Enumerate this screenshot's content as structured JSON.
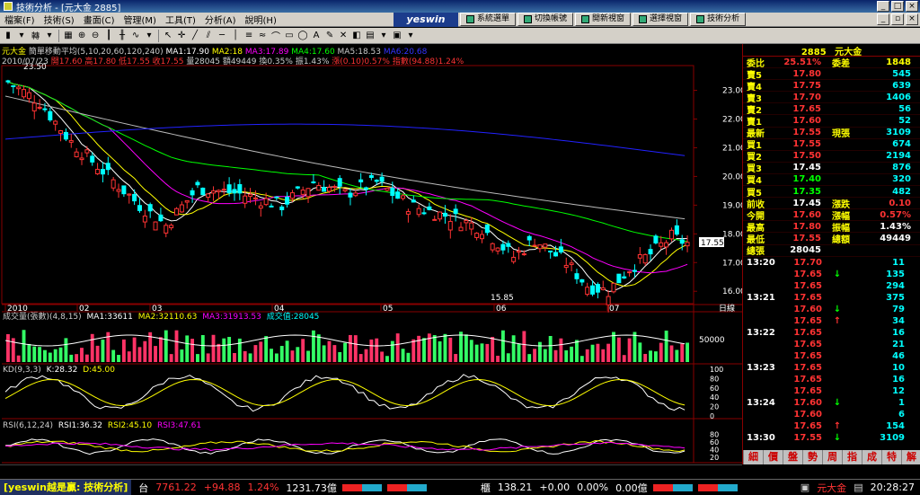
{
  "window": {
    "title": "技術分析 - [元大金 2885]"
  },
  "menu": {
    "items": [
      "檔案(F)",
      "技術(S)",
      "畫面(C)",
      "管理(M)",
      "工具(T)",
      "分析(A)",
      "說明(H)"
    ],
    "logo": "yeswin",
    "top_buttons": [
      "系統選單",
      "切換帳號",
      "開新視窗",
      "選擇視窗",
      "技術分析"
    ]
  },
  "toolbar": {
    "bar_mode_label": "轉"
  },
  "chart_header": {
    "line1_stock": "元大金",
    "line1_rest": "簡單移動平均(5,10,20,60,120,240)",
    "ma1": "MA1:17.90",
    "ma2": "MA2:18",
    "ma3": "MA3:17.89",
    "ma4": "MA4:17.60",
    "ma5": "MA5:18.53",
    "ma6": "MA6:20.68",
    "line2_date": "2010/07/23",
    "line2_open": "開17.60",
    "line2_high": "高17.80",
    "line2_low": "低17.55",
    "line2_close": "收17.55",
    "line2_vol": "量28045",
    "line2_amt": "額49449",
    "line2_turn": "換0.35%",
    "line2_amp": "振1.43%",
    "line2_chg": "漲(0.10)0.57%",
    "line2_idx": "指數(94.88)1.24%",
    "max_label": "23.50",
    "min_label": "15.85",
    "price_tag": "17.55",
    "volume_header": {
      "name": "成交量(張數)(4,8,15)",
      "ma1": "MA1:33611",
      "ma2": "MA2:32110.63",
      "ma3": "MA3:31913.53",
      "current": "成交值:28045"
    },
    "kd_header": {
      "name": "KD(9,3,3)",
      "k": "K:28.32",
      "d": "D:45.00"
    },
    "rsi_header": {
      "name": "RSI(6,12,24)",
      "rsi1": "RSI1:36.32",
      "rsi2": "RSI2:45.10",
      "rsi3": "RSI3:47.61"
    },
    "period_label": "日線"
  },
  "chart_data": {
    "type": "candlestick",
    "x_ticks": [
      "2010",
      "02",
      "03",
      "04",
      "05",
      "06",
      "07"
    ],
    "price_axis": [
      "23.00",
      "22.00",
      "21.00",
      "20.00",
      "19.00",
      "18.00",
      "17.00",
      "16.00"
    ],
    "volume_axis": [
      "50000"
    ],
    "kd_axis": [
      "100",
      "80",
      "60",
      "40",
      "20",
      "0"
    ],
    "rsi_axis": [
      "80",
      "60",
      "40",
      "20"
    ],
    "ylim_price": [
      15.6,
      23.8
    ],
    "max_close": 23.5,
    "min_close": 15.85,
    "last_close": 17.55
  },
  "quote": {
    "title_code": "2885",
    "title_name": "元大金",
    "rows": [
      {
        "lbl": "委比",
        "v1": "25.51%",
        "lbl2": "委差",
        "v2": "1848",
        "c1": "#f33",
        "c2": "#ff0"
      },
      {
        "lbl": "賣5",
        "v1": "17.80",
        "lbl2": "",
        "v2": "545",
        "c1": "#f33",
        "c2": "#0ff"
      },
      {
        "lbl": "賣4",
        "v1": "17.75",
        "lbl2": "",
        "v2": "639",
        "c1": "#f33",
        "c2": "#0ff"
      },
      {
        "lbl": "賣3",
        "v1": "17.70",
        "lbl2": "",
        "v2": "1406",
        "c1": "#f33",
        "c2": "#0ff"
      },
      {
        "lbl": "賣2",
        "v1": "17.65",
        "lbl2": "",
        "v2": "56",
        "c1": "#f33",
        "c2": "#0ff"
      },
      {
        "lbl": "賣1",
        "v1": "17.60",
        "lbl2": "",
        "v2": "52",
        "c1": "#f33",
        "c2": "#0ff"
      },
      {
        "lbl": "最新",
        "v1": "17.55",
        "lbl2": "現張",
        "v2": "3109",
        "c1": "#f33",
        "c2": "#0ff"
      },
      {
        "lbl": "買1",
        "v1": "17.55",
        "lbl2": "",
        "v2": "674",
        "c1": "#f33",
        "c2": "#0ff"
      },
      {
        "lbl": "買2",
        "v1": "17.50",
        "lbl2": "",
        "v2": "2194",
        "c1": "#f33",
        "c2": "#0ff"
      },
      {
        "lbl": "買3",
        "v1": "17.45",
        "lbl2": "",
        "v2": "876",
        "c1": "#fff",
        "c2": "#0ff"
      },
      {
        "lbl": "買4",
        "v1": "17.40",
        "lbl2": "",
        "v2": "320",
        "c1": "#0f0",
        "c2": "#0ff"
      },
      {
        "lbl": "買5",
        "v1": "17.35",
        "lbl2": "",
        "v2": "482",
        "c1": "#0f0",
        "c2": "#0ff"
      },
      {
        "lbl": "前收",
        "v1": "17.45",
        "lbl2": "漲跌",
        "v2": "0.10",
        "c1": "#fff",
        "c2": "#f33"
      },
      {
        "lbl": "今開",
        "v1": "17.60",
        "lbl2": "漲幅",
        "v2": "0.57%",
        "c1": "#f33",
        "c2": "#f33"
      },
      {
        "lbl": "最高",
        "v1": "17.80",
        "lbl2": "振幅",
        "v2": "1.43%",
        "c1": "#f33",
        "c2": "#fff"
      },
      {
        "lbl": "最低",
        "v1": "17.55",
        "lbl2": "總額",
        "v2": "49449",
        "c1": "#f33",
        "c2": "#fff"
      },
      {
        "lbl": "總張",
        "v1": "28045",
        "lbl2": "",
        "v2": "",
        "c1": "#fff",
        "c2": "#fff"
      }
    ],
    "ticks": [
      {
        "t": "13:20",
        "p": "17.70",
        "ar": "",
        "vol": "11",
        "cp": "#f33"
      },
      {
        "t": "",
        "p": "17.65",
        "ar": "↓",
        "vol": "135",
        "cp": "#f33"
      },
      {
        "t": "",
        "p": "17.65",
        "ar": "",
        "vol": "294",
        "cp": "#f33"
      },
      {
        "t": "13:21",
        "p": "17.65",
        "ar": "",
        "vol": "375",
        "cp": "#f33"
      },
      {
        "t": "",
        "p": "17.60",
        "ar": "↓",
        "vol": "79",
        "cp": "#f33"
      },
      {
        "t": "",
        "p": "17.65",
        "ar": "↑",
        "vol": "34",
        "cp": "#f33"
      },
      {
        "t": "13:22",
        "p": "17.65",
        "ar": "",
        "vol": "16",
        "cp": "#f33"
      },
      {
        "t": "",
        "p": "17.65",
        "ar": "",
        "vol": "21",
        "cp": "#f33"
      },
      {
        "t": "",
        "p": "17.65",
        "ar": "",
        "vol": "46",
        "cp": "#f33"
      },
      {
        "t": "13:23",
        "p": "17.65",
        "ar": "",
        "vol": "10",
        "cp": "#f33"
      },
      {
        "t": "",
        "p": "17.65",
        "ar": "",
        "vol": "16",
        "cp": "#f33"
      },
      {
        "t": "",
        "p": "17.65",
        "ar": "",
        "vol": "12",
        "cp": "#f33"
      },
      {
        "t": "13:24",
        "p": "17.60",
        "ar": "↓",
        "vol": "1",
        "cp": "#f33"
      },
      {
        "t": "",
        "p": "17.60",
        "ar": "",
        "vol": "6",
        "cp": "#f33"
      },
      {
        "t": "",
        "p": "17.65",
        "ar": "↑",
        "vol": "154",
        "cp": "#f33"
      },
      {
        "t": "13:30",
        "p": "17.55",
        "ar": "↓",
        "vol": "3109",
        "cp": "#f33"
      }
    ],
    "tabs": [
      "細",
      "價",
      "盤",
      "勢",
      "周",
      "指",
      "成",
      "特",
      "解"
    ]
  },
  "status": {
    "brand": "[yeswin越是贏: 技術分析]",
    "market1_name": "台",
    "market1_index": "7761.22",
    "market1_chg": "+94.88",
    "market1_pct": "1.24%",
    "market1_amt": "1231.73億",
    "market2_name": "櫃",
    "market2_index": "138.21",
    "market2_chg": "+0.00",
    "market2_pct": "0.00%",
    "market2_amt": "0.00億",
    "quick_stock": "元大金",
    "clock": "20:28:27"
  }
}
